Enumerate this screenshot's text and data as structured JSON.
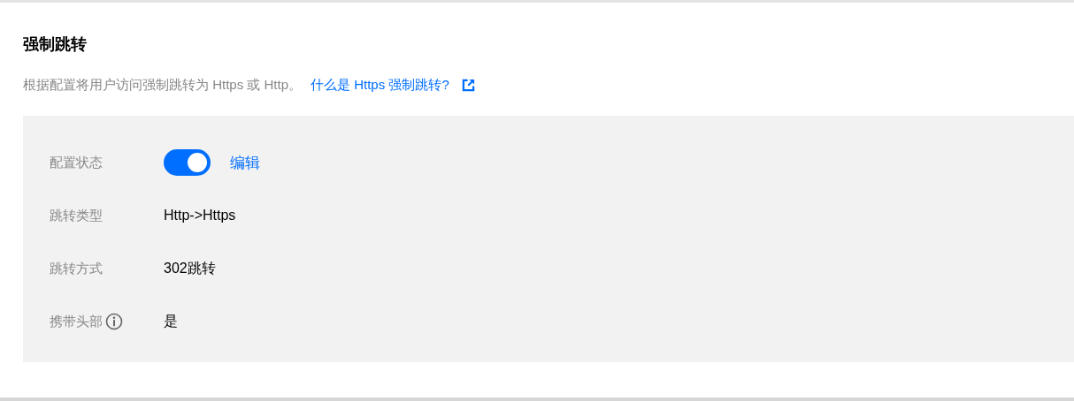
{
  "section": {
    "title": "强制跳转",
    "description": "根据配置将用户访问强制跳转为 Https 或 Http。",
    "help_link": "什么是 Https 强制跳转?"
  },
  "settings": [
    {
      "kind": "toggle",
      "label": "配置状态",
      "on": true,
      "action": "编辑"
    },
    {
      "kind": "text",
      "label": "跳转类型",
      "value": "Http->Https"
    },
    {
      "kind": "text",
      "label": "跳转方式",
      "value": "302跳转"
    },
    {
      "kind": "text",
      "label": "携带头部",
      "value": "是",
      "info": true
    }
  ]
}
